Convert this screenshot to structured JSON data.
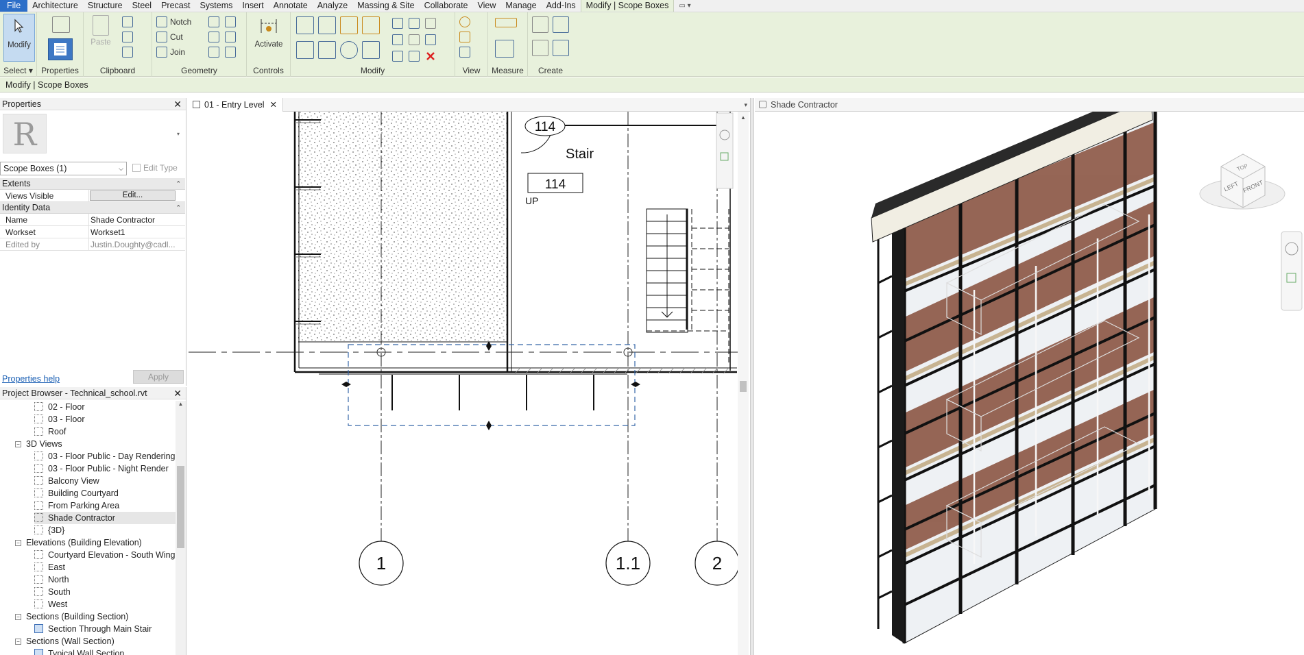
{
  "ribbon_tabs": [
    "File",
    "Architecture",
    "Structure",
    "Steel",
    "Precast",
    "Systems",
    "Insert",
    "Annotate",
    "Analyze",
    "Massing & Site",
    "Collaborate",
    "View",
    "Manage",
    "Add-Ins",
    "Modify | Scope Boxes"
  ],
  "ribbon": {
    "modify_label": "Modify",
    "paste_label": "Paste",
    "notch_label": "Notch",
    "cut_label": "Cut",
    "join_label": "Join",
    "activate_label": "Activate",
    "groups": {
      "select": "Select",
      "properties": "Properties",
      "clipboard": "Clipboard",
      "geometry": "Geometry",
      "controls": "Controls",
      "modify": "Modify",
      "view": "View",
      "measure": "Measure",
      "create": "Create"
    }
  },
  "context_bar": "Modify | Scope Boxes",
  "properties": {
    "title": "Properties",
    "type_selector": "Scope Boxes (1)",
    "edit_type": "Edit Type",
    "sections": {
      "extents": "Extents",
      "identity": "Identity Data"
    },
    "rows": {
      "views_visible": {
        "key": "Views Visible",
        "button": "Edit..."
      },
      "name": {
        "key": "Name",
        "value": "Shade Contractor"
      },
      "workset": {
        "key": "Workset",
        "value": "Workset1"
      },
      "edited_by": {
        "key": "Edited by",
        "value": "Justin.Doughty@cadl..."
      }
    },
    "help_link": "Properties help",
    "apply": "Apply"
  },
  "browser": {
    "title": "Project Browser - Technical_school.rvt",
    "items": [
      {
        "label": "02 - Floor",
        "level": 2,
        "kind": "view"
      },
      {
        "label": "03 - Floor",
        "level": 2,
        "kind": "view"
      },
      {
        "label": "Roof",
        "level": 2,
        "kind": "view"
      },
      {
        "label": "3D Views",
        "level": 1,
        "kind": "group"
      },
      {
        "label": "03 - Floor Public - Day Rendering",
        "level": 2,
        "kind": "view"
      },
      {
        "label": "03 - Floor Public - Night Render",
        "level": 2,
        "kind": "view"
      },
      {
        "label": "Balcony View",
        "level": 2,
        "kind": "view"
      },
      {
        "label": "Building Courtyard",
        "level": 2,
        "kind": "view"
      },
      {
        "label": "From Parking Area",
        "level": 2,
        "kind": "view"
      },
      {
        "label": "Shade Contractor",
        "level": 2,
        "kind": "view",
        "selected": true
      },
      {
        "label": "{3D}",
        "level": 2,
        "kind": "view"
      },
      {
        "label": "Elevations (Building Elevation)",
        "level": 1,
        "kind": "group"
      },
      {
        "label": "Courtyard Elevation - South Wing",
        "level": 2,
        "kind": "view"
      },
      {
        "label": "East",
        "level": 2,
        "kind": "view"
      },
      {
        "label": "North",
        "level": 2,
        "kind": "view"
      },
      {
        "label": "South",
        "level": 2,
        "kind": "view"
      },
      {
        "label": "West",
        "level": 2,
        "kind": "view"
      },
      {
        "label": "Sections (Building Section)",
        "level": 1,
        "kind": "group"
      },
      {
        "label": "Section Through Main Stair",
        "level": 2,
        "kind": "section"
      },
      {
        "label": "Sections (Wall Section)",
        "level": 1,
        "kind": "group"
      },
      {
        "label": "Typical Wall Section",
        "level": 2,
        "kind": "section"
      }
    ]
  },
  "views": {
    "plan_tab": "01 - Entry Level",
    "threed_tab": "Shade Contractor"
  },
  "plan": {
    "room_number": "114",
    "room_name": "Stair",
    "tag_number": "114",
    "stair_label": "UP",
    "grids": [
      "1",
      "1.1",
      "2"
    ]
  },
  "viewcube": {
    "left": "LEFT",
    "front": "FRONT",
    "top": "TOP"
  }
}
